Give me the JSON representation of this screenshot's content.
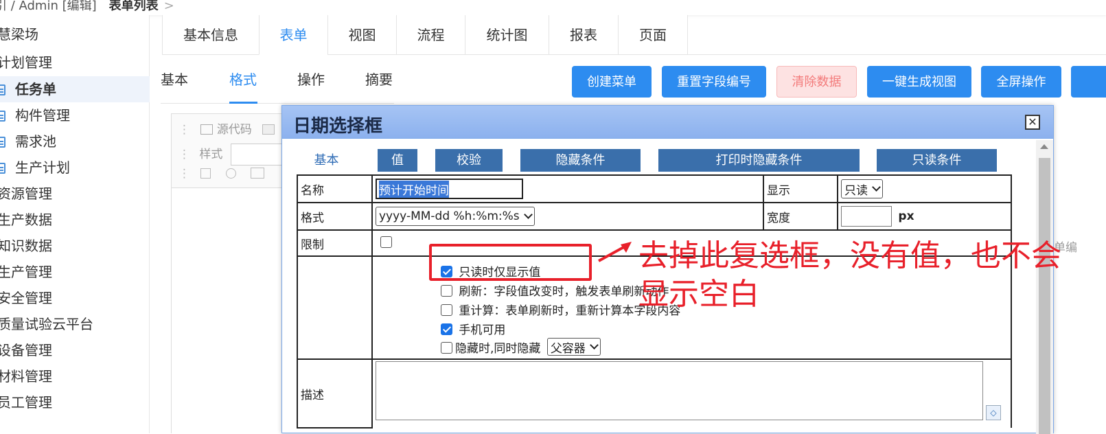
{
  "breadcrumb": {
    "left": "引 / Admin [编辑]",
    "current": "表单列表",
    "sep": ">"
  },
  "sidebar": {
    "items": [
      {
        "label": "慧梁场",
        "icon": ""
      },
      {
        "label": "计划管理",
        "icon": ""
      },
      {
        "label": "任务单",
        "icon": "document-icon",
        "active": true
      },
      {
        "label": "构件管理",
        "icon": "document-icon"
      },
      {
        "label": "需求池",
        "icon": "document-icon"
      },
      {
        "label": "生产计划",
        "icon": "document-icon"
      },
      {
        "label": "资源管理",
        "icon": ""
      },
      {
        "label": "生产数据",
        "icon": ""
      },
      {
        "label": "知识数据",
        "icon": ""
      },
      {
        "label": "生产管理",
        "icon": ""
      },
      {
        "label": "安全管理",
        "icon": ""
      },
      {
        "label": "质量试验云平台",
        "icon": ""
      },
      {
        "label": "设备管理",
        "icon": ""
      },
      {
        "label": "材料管理",
        "icon": ""
      },
      {
        "label": "员工管理",
        "icon": ""
      }
    ]
  },
  "main_tabs": [
    "基本信息",
    "表单",
    "视图",
    "流程",
    "统计图",
    "报表",
    "页面"
  ],
  "main_tab_active": "表单",
  "sub_tabs": [
    "基本",
    "格式",
    "操作",
    "摘要"
  ],
  "sub_tab_active": "格式",
  "buttons": {
    "create_menu": "创建菜单",
    "reset_field_no": "重置字段编号",
    "clear_data": "清除数据",
    "gen_view": "一键生成视图",
    "fullscreen": "全屏操作"
  },
  "editor": {
    "source": "源代码",
    "style_label": "样式",
    "right_cut_text": "单编"
  },
  "dialog": {
    "title": "日期选择框",
    "tabs": [
      "基本",
      "值",
      "校验",
      "隐藏条件",
      "打印时隐藏条件",
      "只读条件"
    ],
    "tab_active": "基本",
    "form": {
      "name_label": "名称",
      "name_value": "预计开始时间",
      "display_label": "显示",
      "display_value": "只读",
      "format_label": "格式",
      "format_value": "yyyy-MM-dd %h:%m:%s",
      "width_label": "宽度",
      "width_value": "",
      "width_unit": "px",
      "limit_label": "限制",
      "desc_label": "描述",
      "options": [
        {
          "label": "只读时仅显示值",
          "checked": true
        },
        {
          "label": "刷新：字段值改变时，触发表单刷新动作",
          "checked": false
        },
        {
          "label": "重计算：表单刷新时，重新计算本字段内容",
          "checked": false
        },
        {
          "label": "手机可用",
          "checked": true
        },
        {
          "label": "隐藏时,同时隐藏",
          "checked": false
        }
      ],
      "hide_container_value": "父容器"
    }
  },
  "annotation": {
    "text": "去掉此复选框，没有值，也不会显示空白",
    "color": "#e8202a"
  },
  "colors": {
    "accent": "#2d8cf0",
    "dialog_tab": "#3a6fab",
    "danger_bg": "#fde2e2"
  }
}
